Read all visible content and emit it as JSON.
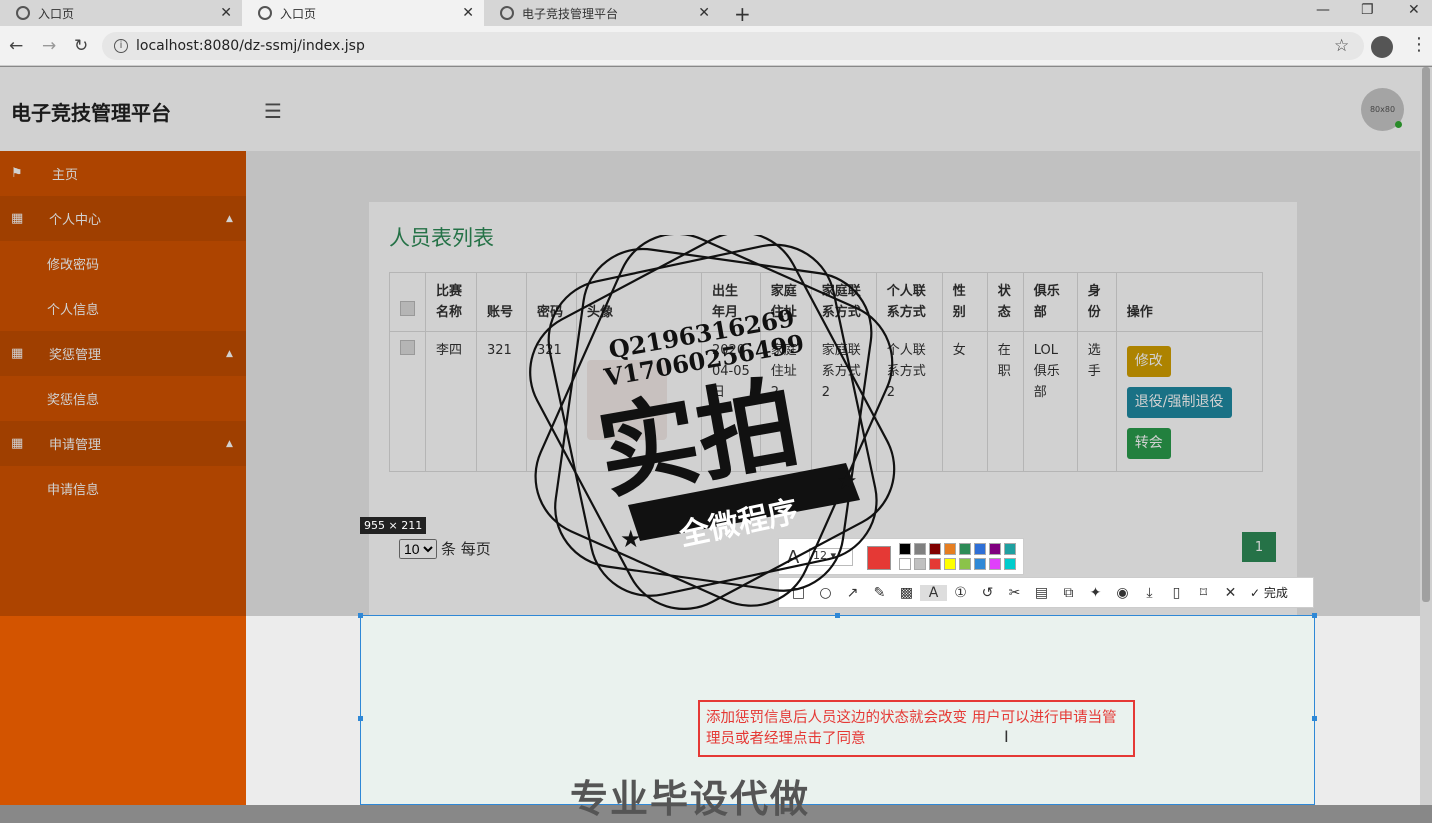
{
  "browser": {
    "tabs": [
      {
        "title": "入口页",
        "active": false
      },
      {
        "title": "入口页",
        "active": true
      },
      {
        "title": "电子竞技管理平台",
        "active": false
      }
    ],
    "new_tab": "+",
    "url": "localhost:8080/dz-ssmj/index.jsp"
  },
  "header": {
    "brand": "电子竞技管理平台",
    "avatar_text": "80x80"
  },
  "sidebar": {
    "items": [
      {
        "label": "主页",
        "icon": "flag-icon",
        "group": false
      },
      {
        "label": "个人中心",
        "icon": "grid-icon",
        "group": true
      },
      {
        "label": "修改密码",
        "group": false,
        "sub": true
      },
      {
        "label": "个人信息",
        "group": false,
        "sub": true
      },
      {
        "label": "奖惩管理",
        "icon": "grid-icon",
        "group": true
      },
      {
        "label": "奖惩信息",
        "group": false,
        "sub": true
      },
      {
        "label": "申请管理",
        "icon": "grid-icon",
        "group": true
      },
      {
        "label": "申请信息",
        "group": false,
        "sub": true
      }
    ]
  },
  "main": {
    "title": "人员表列表",
    "columns": [
      "比赛名称",
      "账号",
      "密码",
      "头像",
      "出生年月",
      "家庭住址",
      "家庭联系方式",
      "个人联系方式",
      "性别",
      "状态",
      "俱乐部",
      "身份",
      "操作"
    ],
    "rows": [
      {
        "cells": [
          "李四",
          "321",
          "321",
          "",
          "2020-04-05日",
          "家庭住址2",
          "家庭联系方式2",
          "个人联系方式2",
          "女",
          "在职",
          "LOL俱乐部",
          "选手"
        ],
        "actions": [
          "修改",
          "退役/强制退役",
          "转会"
        ]
      }
    ],
    "pager": {
      "page_size": "10",
      "suffix": "条 每页",
      "current_page": "1"
    }
  },
  "screenshot_tool": {
    "dimensions": "955 × 211",
    "font_size": "12",
    "current_color": "#e53935",
    "palette": [
      "#000000",
      "#808080",
      "#800000",
      "#e67e22",
      "#2e8b57",
      "#2f6fd6",
      "#800080",
      "#1fa0a0",
      "#ffffff",
      "#c0c0c0",
      "#e53935",
      "#ffff00",
      "#8bc34a",
      "#2f88d6",
      "#e040fb",
      "#00cccc"
    ],
    "done_label": "完成",
    "note_text": "添加惩罚信息后人员这边的状态就会改变 用户可以进行申请当管理员或者经理点击了同意"
  },
  "watermark": {
    "line1": "Q2196316269",
    "line2": "V17060256499",
    "big": "实拍",
    "banner": "全微程序",
    "bottom_text": "专业毕设代做"
  }
}
